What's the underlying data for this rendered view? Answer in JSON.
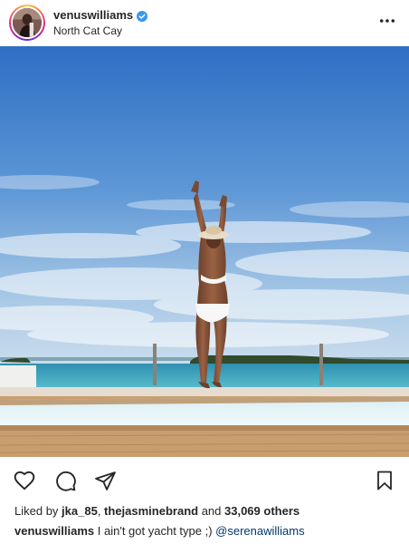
{
  "header": {
    "username": "venuswilliams",
    "location": "North Cat Cay",
    "verified": true,
    "avatar_icon": "profile-avatar",
    "more_icon": "more-options-icon"
  },
  "actions": {
    "like_icon": "heart-icon",
    "comment_icon": "comment-icon",
    "share_icon": "send-icon",
    "save_icon": "bookmark-icon"
  },
  "likes": {
    "prefix": "Liked by ",
    "user1": "jka_85",
    "separator": ", ",
    "user2": "thejasminebrand",
    "middle": " and ",
    "others": "33,069 others"
  },
  "caption": {
    "username": "venuswilliams",
    "text": " I ain't got yacht type ;) ",
    "mention": "@serenawilliams"
  },
  "colors": {
    "text": "#262626",
    "verified": "#3897f0",
    "mention": "#00376b",
    "sky_top": "#2f78c8",
    "sea": "#3fa7bd"
  }
}
